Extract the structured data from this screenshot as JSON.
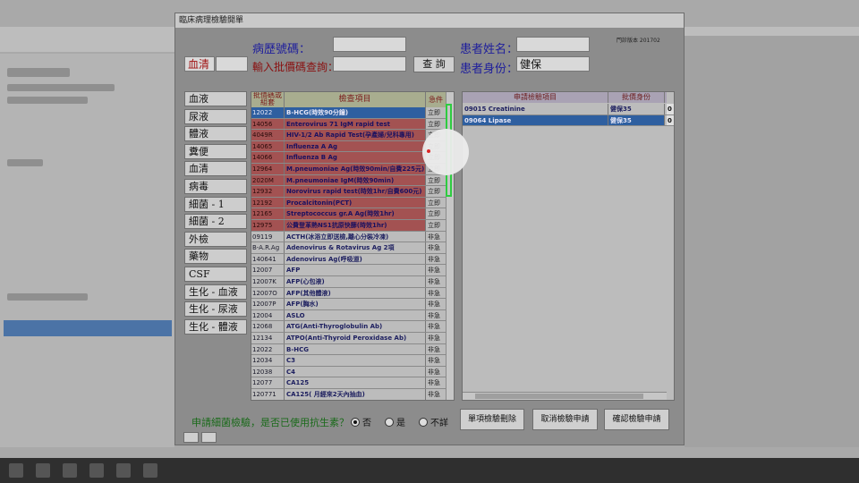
{
  "dialog": {
    "title": "臨床病理檢驗開單",
    "version_label": "門診版本 201702"
  },
  "header": {
    "chart_no_label": "病歷號碼：",
    "chart_no_value": "",
    "patient_name_label": "患者姓名：",
    "patient_name_value": "",
    "specimen_select": "血清",
    "specimen_code": "",
    "batch_query_label": "輸入批價碼查詢：",
    "batch_query_value": "",
    "query_button": "查 詢",
    "patient_id_label": "患者身份：",
    "patient_id_value": "健保"
  },
  "categories": [
    "血液",
    "尿液",
    "體液",
    "糞便",
    "血清",
    "病毒",
    "細菌 - 1",
    "細菌 - 2",
    "外檢",
    "藥物",
    "CSF",
    "生化 - 血液",
    "生化 - 尿液",
    "生化 - 體液"
  ],
  "test_table": {
    "headers": {
      "code": "批價碼或組套",
      "item": "檢查項目",
      "urgency": "急件"
    },
    "rows": [
      {
        "code": "12022",
        "item": "B-HCG(時效90分鐘)",
        "urg": "立即",
        "state": "sel"
      },
      {
        "code": "14056",
        "item": "Enterovirus 71 IgM rapid test",
        "urg": "立即",
        "state": "red"
      },
      {
        "code": "4049R",
        "item": "HIV-1/2 Ab Rapid Test(孕產婦/兒科專用)",
        "urg": "立即",
        "state": "red"
      },
      {
        "code": "14065",
        "item": "Influenza A Ag",
        "urg": "立即",
        "state": "red"
      },
      {
        "code": "14066",
        "item": "Influenza B Ag",
        "urg": "立即",
        "state": "red"
      },
      {
        "code": "12964",
        "item": "M.pneumoniae Ag(時效90min/自費225元)",
        "urg": "立即",
        "state": "red"
      },
      {
        "code": "2020M",
        "item": "M.pneumoniae IgM(時效90min)",
        "urg": "立即",
        "state": "red"
      },
      {
        "code": "12932",
        "item": "Norovirus rapid test(時效1hr/自費600元)",
        "urg": "立即",
        "state": "red"
      },
      {
        "code": "12192",
        "item": "Procalcitonin(PCT)",
        "urg": "立即",
        "state": "red"
      },
      {
        "code": "12165",
        "item": "Streptococcus gr.A Ag(時效1hr)",
        "urg": "立即",
        "state": "red"
      },
      {
        "code": "12975",
        "item": "公費登革熱NS1抗原快篩(時效1hr)",
        "urg": "立即",
        "state": "red"
      },
      {
        "code": "09119",
        "item": "ACTH(冰浴立即送檢,離心分裝冷凍)",
        "urg": "非急",
        "state": ""
      },
      {
        "code": "B-A.R.Ag",
        "item": "Adenovirus & Rotavirus Ag 2項",
        "urg": "非急",
        "state": ""
      },
      {
        "code": "140641",
        "item": "Adenovirus Ag(呼吸道)",
        "urg": "非急",
        "state": ""
      },
      {
        "code": "12007",
        "item": "AFP",
        "urg": "非急",
        "state": ""
      },
      {
        "code": "12007K",
        "item": "AFP(心包液)",
        "urg": "非急",
        "state": ""
      },
      {
        "code": "12007O",
        "item": "AFP(其他體液)",
        "urg": "非急",
        "state": ""
      },
      {
        "code": "12007P",
        "item": "AFP(胸水)",
        "urg": "非急",
        "state": ""
      },
      {
        "code": "12004",
        "item": "ASLO",
        "urg": "非急",
        "state": ""
      },
      {
        "code": "12068",
        "item": "ATG(Anti-Thyroglobulin Ab)",
        "urg": "非急",
        "state": ""
      },
      {
        "code": "12134",
        "item": "ATPO(Anti-Thyroid Peroxidase Ab)",
        "urg": "非急",
        "state": ""
      },
      {
        "code": "12022",
        "item": "B-HCG",
        "urg": "非急",
        "state": ""
      },
      {
        "code": "12034",
        "item": "C3",
        "urg": "非急",
        "state": ""
      },
      {
        "code": "12038",
        "item": "C4",
        "urg": "非急",
        "state": ""
      },
      {
        "code": "12077",
        "item": "CA125",
        "urg": "非急",
        "state": ""
      },
      {
        "code": "120771",
        "item": "CA125( 月經來2天內抽血)",
        "urg": "非急",
        "state": ""
      }
    ]
  },
  "request_table": {
    "headers": {
      "item": "申請檢驗項目",
      "identity": "批價身份"
    },
    "rows": [
      {
        "item": "09015 Creatinine",
        "identity": "健保35",
        "flag": "0",
        "state": ""
      },
      {
        "item": "09064 Lipase",
        "identity": "健保35",
        "flag": "0",
        "state": "sel"
      }
    ]
  },
  "footer": {
    "question": "申請細菌檢驗，是否已使用抗生素？",
    "options": [
      "否",
      "是",
      "不詳"
    ],
    "selected": "否",
    "delete_button": "單項檢驗刪除",
    "cancel_button": "取消檢驗申請",
    "confirm_button": "確認檢驗申請"
  },
  "colors": {
    "urgent_row": "#a35252",
    "selected_row": "#2e5fa0",
    "highlight_border": "#2ecc40"
  }
}
